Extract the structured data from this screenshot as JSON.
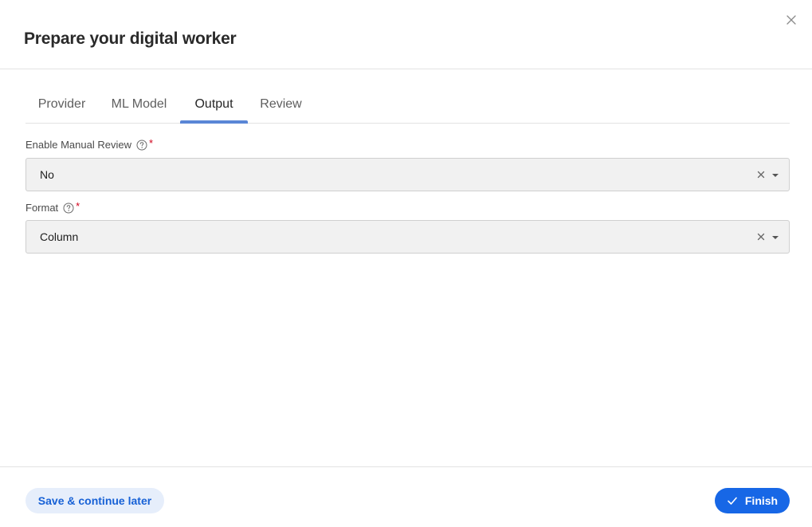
{
  "dialog": {
    "title": "Prepare your digital worker"
  },
  "tabs": [
    {
      "label": "Provider",
      "active": false
    },
    {
      "label": "ML Model",
      "active": false
    },
    {
      "label": "Output",
      "active": true
    },
    {
      "label": "Review",
      "active": false
    }
  ],
  "fields": {
    "manual_review": {
      "label": "Enable Manual Review",
      "required_mark": "*",
      "value": "No"
    },
    "format": {
      "label": "Format",
      "required_mark": "*",
      "value": "Column"
    }
  },
  "footer": {
    "save_label": "Save & continue later",
    "finish_label": "Finish"
  },
  "icons": {
    "close": "close-icon",
    "help": "help-icon",
    "clear": "clear-icon",
    "caret": "chevron-down-icon",
    "check": "check-icon"
  },
  "colors": {
    "accent": "#1767e6",
    "tab_indicator": "#5a86d6",
    "required": "#d0021b",
    "secondary_button_bg": "#e6eefb"
  }
}
